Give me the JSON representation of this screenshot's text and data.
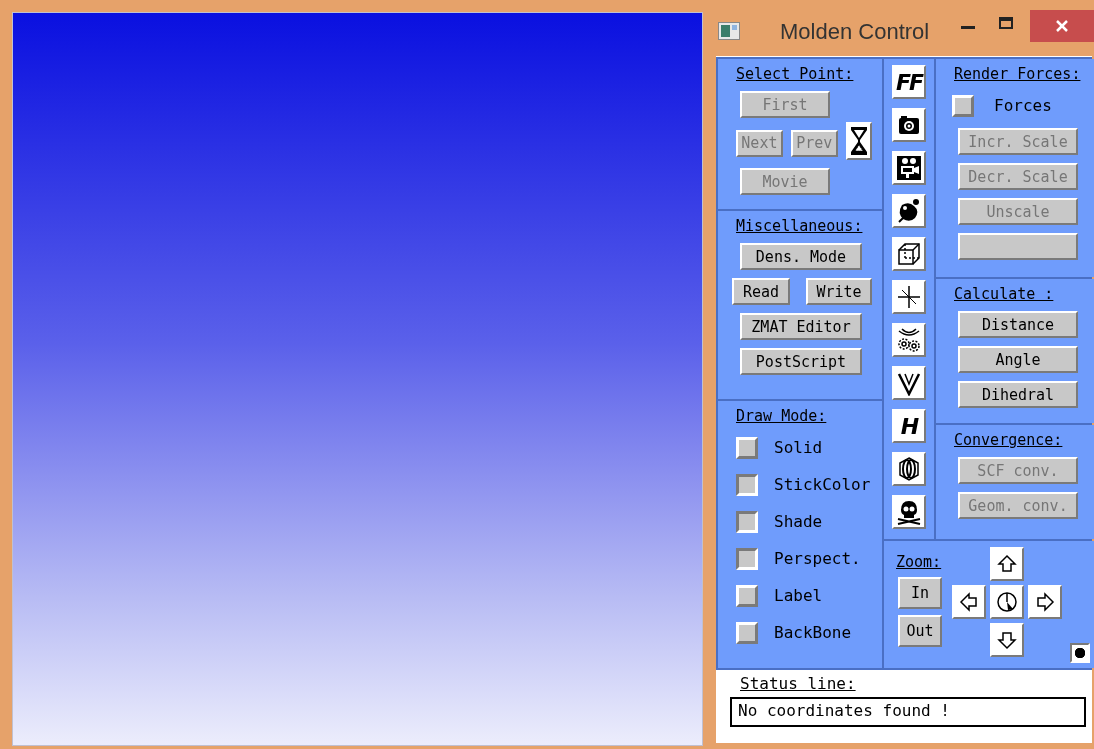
{
  "window": {
    "title": "Molden Control"
  },
  "select_point": {
    "heading": "Select Point:",
    "buttons": [
      {
        "label": "First",
        "disabled": true
      },
      {
        "label": "Next",
        "disabled": true
      },
      {
        "label": "Prev",
        "disabled": true
      },
      {
        "label": "Movie",
        "disabled": true
      }
    ]
  },
  "miscellaneous": {
    "heading": "Miscellaneous:",
    "buttons": [
      {
        "label": "Dens. Mode",
        "disabled": false
      },
      {
        "label": "Read",
        "disabled": false
      },
      {
        "label": "Write",
        "disabled": false
      },
      {
        "label": "ZMAT Editor",
        "disabled": false
      },
      {
        "label": "PostScript",
        "disabled": false
      }
    ]
  },
  "draw_mode": {
    "heading": "Draw Mode:",
    "options": [
      {
        "label": "Solid",
        "checked": false
      },
      {
        "label": "StickColor",
        "checked": true
      },
      {
        "label": "Shade",
        "checked": true
      },
      {
        "label": "Perspect.",
        "checked": true
      },
      {
        "label": "Label",
        "checked": false
      },
      {
        "label": "BackBone",
        "checked": false
      }
    ]
  },
  "toolbar": [
    {
      "kind": "text",
      "label": "FF"
    },
    {
      "kind": "camera"
    },
    {
      "kind": "movie"
    },
    {
      "kind": "blob"
    },
    {
      "kind": "cube"
    },
    {
      "kind": "axes"
    },
    {
      "kind": "gears"
    },
    {
      "kind": "vee"
    },
    {
      "kind": "text",
      "label": "H"
    },
    {
      "kind": "ring"
    },
    {
      "kind": "skull"
    }
  ],
  "render_forces": {
    "heading": "Render Forces:",
    "forces": {
      "label": "Forces",
      "checked": false
    },
    "buttons": [
      {
        "label": "Incr. Scale",
        "disabled": true
      },
      {
        "label": "Decr. Scale",
        "disabled": true
      },
      {
        "label": "Unscale",
        "disabled": true
      }
    ]
  },
  "calculate": {
    "heading": "Calculate :",
    "buttons": [
      {
        "label": "Distance",
        "disabled": false
      },
      {
        "label": "Angle",
        "disabled": false
      },
      {
        "label": "Dihedral",
        "disabled": false
      }
    ]
  },
  "convergence": {
    "heading": "Convergence:",
    "buttons": [
      {
        "label": "SCF conv.",
        "disabled": true
      },
      {
        "label": "Geom. conv.",
        "disabled": true
      }
    ]
  },
  "zoom": {
    "heading": "Zoom:",
    "buttons": [
      {
        "label": "In"
      },
      {
        "label": "Out"
      }
    ],
    "dot": {
      "selected": true
    }
  },
  "status": {
    "heading": "Status line:",
    "value": "No coordinates found !"
  }
}
